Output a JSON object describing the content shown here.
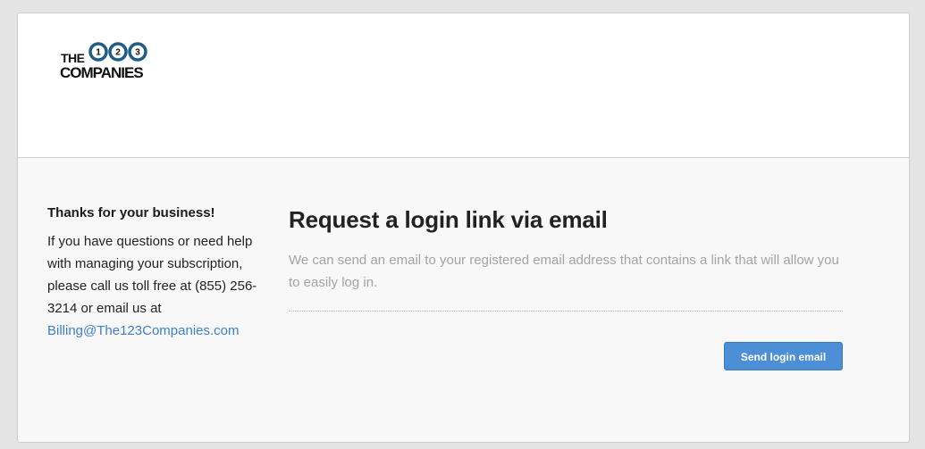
{
  "logo": {
    "the": "THE",
    "digits": [
      "1",
      "2",
      "3"
    ],
    "companies": "COMPANIES"
  },
  "sidebar": {
    "heading": "Thanks for your business!",
    "body_text": "If you have questions or need help with managing your subscription, please call us toll free at (855) 256-3214 or email us at",
    "email": "Billing@The123Companies.com"
  },
  "main": {
    "title": "Request a login link via email",
    "description": "We can send an email to your registered email address that contains a link that will allow you to easily log in.",
    "send_button_label": "Send login email"
  },
  "colors": {
    "page_bg": "#e4e4e4",
    "card_bg": "#f8f8f8",
    "header_bg": "#ffffff",
    "link": "#3d7fc9",
    "button": "#4d8fd6",
    "logo_ring": "#1f5d87"
  }
}
